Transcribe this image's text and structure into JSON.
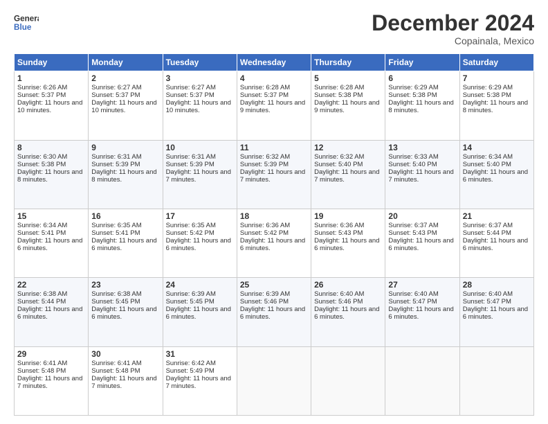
{
  "logo": {
    "line1": "General",
    "line2": "Blue"
  },
  "title": "December 2024",
  "subtitle": "Copainala, Mexico",
  "headers": [
    "Sunday",
    "Monday",
    "Tuesday",
    "Wednesday",
    "Thursday",
    "Friday",
    "Saturday"
  ],
  "weeks": [
    [
      {
        "day": "1",
        "sunrise": "6:26 AM",
        "sunset": "5:37 PM",
        "daylight": "11 hours and 10 minutes."
      },
      {
        "day": "2",
        "sunrise": "6:27 AM",
        "sunset": "5:37 PM",
        "daylight": "11 hours and 10 minutes."
      },
      {
        "day": "3",
        "sunrise": "6:27 AM",
        "sunset": "5:37 PM",
        "daylight": "11 hours and 10 minutes."
      },
      {
        "day": "4",
        "sunrise": "6:28 AM",
        "sunset": "5:37 PM",
        "daylight": "11 hours and 9 minutes."
      },
      {
        "day": "5",
        "sunrise": "6:28 AM",
        "sunset": "5:38 PM",
        "daylight": "11 hours and 9 minutes."
      },
      {
        "day": "6",
        "sunrise": "6:29 AM",
        "sunset": "5:38 PM",
        "daylight": "11 hours and 8 minutes."
      },
      {
        "day": "7",
        "sunrise": "6:29 AM",
        "sunset": "5:38 PM",
        "daylight": "11 hours and 8 minutes."
      }
    ],
    [
      {
        "day": "8",
        "sunrise": "6:30 AM",
        "sunset": "5:38 PM",
        "daylight": "11 hours and 8 minutes."
      },
      {
        "day": "9",
        "sunrise": "6:31 AM",
        "sunset": "5:39 PM",
        "daylight": "11 hours and 8 minutes."
      },
      {
        "day": "10",
        "sunrise": "6:31 AM",
        "sunset": "5:39 PM",
        "daylight": "11 hours and 7 minutes."
      },
      {
        "day": "11",
        "sunrise": "6:32 AM",
        "sunset": "5:39 PM",
        "daylight": "11 hours and 7 minutes."
      },
      {
        "day": "12",
        "sunrise": "6:32 AM",
        "sunset": "5:40 PM",
        "daylight": "11 hours and 7 minutes."
      },
      {
        "day": "13",
        "sunrise": "6:33 AM",
        "sunset": "5:40 PM",
        "daylight": "11 hours and 7 minutes."
      },
      {
        "day": "14",
        "sunrise": "6:34 AM",
        "sunset": "5:40 PM",
        "daylight": "11 hours and 6 minutes."
      }
    ],
    [
      {
        "day": "15",
        "sunrise": "6:34 AM",
        "sunset": "5:41 PM",
        "daylight": "11 hours and 6 minutes."
      },
      {
        "day": "16",
        "sunrise": "6:35 AM",
        "sunset": "5:41 PM",
        "daylight": "11 hours and 6 minutes."
      },
      {
        "day": "17",
        "sunrise": "6:35 AM",
        "sunset": "5:42 PM",
        "daylight": "11 hours and 6 minutes."
      },
      {
        "day": "18",
        "sunrise": "6:36 AM",
        "sunset": "5:42 PM",
        "daylight": "11 hours and 6 minutes."
      },
      {
        "day": "19",
        "sunrise": "6:36 AM",
        "sunset": "5:43 PM",
        "daylight": "11 hours and 6 minutes."
      },
      {
        "day": "20",
        "sunrise": "6:37 AM",
        "sunset": "5:43 PM",
        "daylight": "11 hours and 6 minutes."
      },
      {
        "day": "21",
        "sunrise": "6:37 AM",
        "sunset": "5:44 PM",
        "daylight": "11 hours and 6 minutes."
      }
    ],
    [
      {
        "day": "22",
        "sunrise": "6:38 AM",
        "sunset": "5:44 PM",
        "daylight": "11 hours and 6 minutes."
      },
      {
        "day": "23",
        "sunrise": "6:38 AM",
        "sunset": "5:45 PM",
        "daylight": "11 hours and 6 minutes."
      },
      {
        "day": "24",
        "sunrise": "6:39 AM",
        "sunset": "5:45 PM",
        "daylight": "11 hours and 6 minutes."
      },
      {
        "day": "25",
        "sunrise": "6:39 AM",
        "sunset": "5:46 PM",
        "daylight": "11 hours and 6 minutes."
      },
      {
        "day": "26",
        "sunrise": "6:40 AM",
        "sunset": "5:46 PM",
        "daylight": "11 hours and 6 minutes."
      },
      {
        "day": "27",
        "sunrise": "6:40 AM",
        "sunset": "5:47 PM",
        "daylight": "11 hours and 6 minutes."
      },
      {
        "day": "28",
        "sunrise": "6:40 AM",
        "sunset": "5:47 PM",
        "daylight": "11 hours and 6 minutes."
      }
    ],
    [
      {
        "day": "29",
        "sunrise": "6:41 AM",
        "sunset": "5:48 PM",
        "daylight": "11 hours and 7 minutes."
      },
      {
        "day": "30",
        "sunrise": "6:41 AM",
        "sunset": "5:48 PM",
        "daylight": "11 hours and 7 minutes."
      },
      {
        "day": "31",
        "sunrise": "6:42 AM",
        "sunset": "5:49 PM",
        "daylight": "11 hours and 7 minutes."
      },
      null,
      null,
      null,
      null
    ]
  ]
}
